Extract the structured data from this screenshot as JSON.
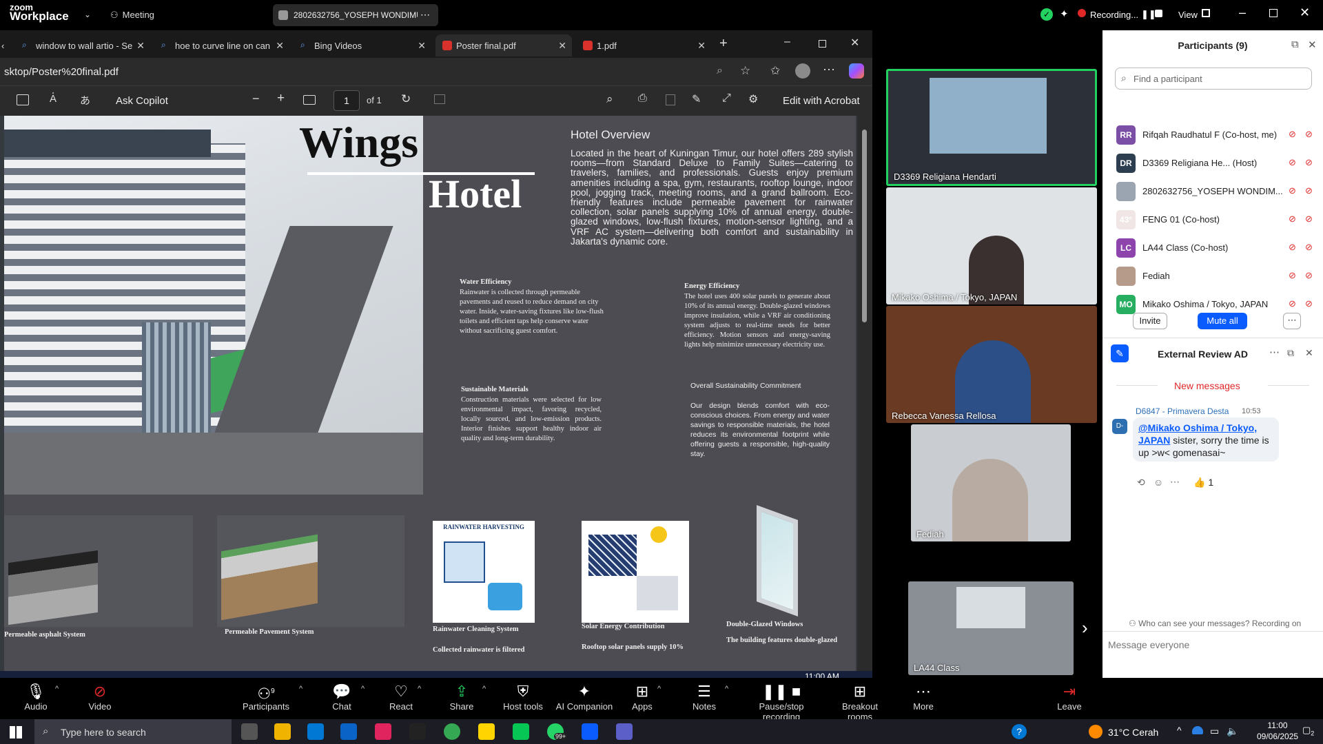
{
  "zoom_top": {
    "brand_small": "zoom",
    "brand_large": "Workplace",
    "meeting_label": "Meeting",
    "shared_screen_label": "2802632756_YOSEPH WONDIMU I",
    "recording_label": "Recording...",
    "view_label": "View"
  },
  "browser": {
    "tabs": [
      {
        "label": "window to wall artio - Se",
        "active": false
      },
      {
        "label": "hoe to curve line on can",
        "active": false
      },
      {
        "label": "Bing Videos",
        "active": false
      },
      {
        "label": "Poster final.pdf",
        "active": true
      },
      {
        "label": "1.pdf",
        "active": false
      }
    ],
    "address": "sktop/Poster%20final.pdf",
    "pdf_toolbar": {
      "ask_copilot": "Ask Copilot",
      "page_current": "1",
      "page_total": "of 1",
      "edit_acrobat": "Edit with Acrobat"
    }
  },
  "poster": {
    "title_1": "Wings",
    "title_2": "Hotel",
    "overview_heading": "Hotel Overview",
    "overview_body": "Located in the heart of Kuningan Timur, our hotel offers 289 stylish rooms—from Standard Deluxe to Family Suites—catering to travelers, families, and professionals. Guests enjoy premium amenities including a spa, gym, restaurants, rooftop lounge, indoor pool, jogging track, meeting rooms, and a grand ballroom. Eco-friendly features include permeable pavement for rainwater collection, solar panels supplying 10% of annual energy, double-glazed windows, low-flush fixtures, motion-sensor lighting, and a VRF AC system—delivering both comfort and sustainability in Jakarta's dynamic core.",
    "water_heading": "Water Efficiency",
    "water_body": "Rainwater is collected through permeable pavements and reused to reduce demand on city water. Inside, water-saving fixtures like low-flush toilets and efficient taps help conserve water without sacrificing guest comfort.",
    "energy_heading": "Energy Efficiency",
    "energy_body": "The hotel uses 400 solar panels to generate about 10% of its annual energy. Double-glazed windows improve insulation, while a VRF air conditioning system adjusts to real-time needs for better efficiency. Motion sensors and energy-saving lights help minimize unnecessary electricity use.",
    "materials_heading": "Sustainable Materials",
    "materials_body": "Construction materials were selected for low environmental impact, favoring recycled, locally sourced, and low-emission products. Interior finishes support healthy indoor air quality and long-term durability.",
    "commitment_heading": "Overall Sustainability Commitment",
    "commitment_body": "Our design blends comfort with eco-conscious choices. From energy and water savings to responsible materials, the hotel reduces its environmental footprint while offering guests a responsible, high-quality stay.",
    "rainwater_graphic_title": "RAINWATER HARVESTING",
    "captions": [
      "Permeable asphalt System",
      "Permeable Pavement System",
      "Rainwater Cleaning System",
      "Solar Energy Contribution",
      "Double-Glazed Windows"
    ],
    "cut_lines": [
      "Collected rainwater is filtered",
      "Rooftop solar panels supply 10%",
      "The building features double-glazed"
    ]
  },
  "videos": [
    {
      "name": "D3369 Religiana Hendarti"
    },
    {
      "name": "Mikako Oshima / Tokyo, JAPAN"
    },
    {
      "name": "Rebecca Vanessa Rellosa"
    },
    {
      "name": "Fediah"
    },
    {
      "name": "LA44 Class"
    }
  ],
  "participants": {
    "title": "Participants (9)",
    "search_placeholder": "Find a participant",
    "list": [
      {
        "initials": "RR",
        "name": "Rifqah Raudhatul F (Co-host, me)",
        "color": "#7b4fa6"
      },
      {
        "initials": "DR",
        "name": "D3369 Religiana He... (Host)",
        "color": "#2d3e50"
      },
      {
        "initials": "",
        "name": "2802632756_YOSEPH WONDIM...",
        "color": "#9aa5b1"
      },
      {
        "initials": "43°",
        "name": "FENG 01 (Co-host)",
        "color": "#f0e6e6"
      },
      {
        "initials": "LC",
        "name": "LA44 Class (Co-host)",
        "color": "#8e44ad"
      },
      {
        "initials": "",
        "name": "Fediah",
        "color": "#b69a8a"
      },
      {
        "initials": "MO",
        "name": "Mikako Oshima / Tokyo, JAPAN",
        "color": "#27ae60"
      }
    ],
    "invite": "Invite",
    "mute_all": "Mute all"
  },
  "chat": {
    "title": "External Review AD",
    "new_messages": "New messages",
    "sender": "D6847 - Primavera Desta",
    "time": "10:53",
    "mention": "@Mikako Oshima / Tokyo, JAPAN",
    "message": " sister, sorry the time is up >w< gomenasai~",
    "reaction_count": "1",
    "who_can_see": "Who can see your messages? Recording on",
    "input_placeholder": "Message everyone"
  },
  "zoom_bar": {
    "audio": "Audio",
    "video": "Video",
    "participants": "Participants",
    "participants_count": "9",
    "chat": "Chat",
    "react": "React",
    "share": "Share",
    "host_tools": "Host tools",
    "ai_companion": "AI Companion",
    "apps": "Apps",
    "notes": "Notes",
    "pause_recording": "Pause/stop recording",
    "breakout": "Breakout rooms",
    "more": "More",
    "leave": "Leave"
  },
  "taskbar": {
    "search_placeholder": "Type here to search",
    "weather": "31°C  Cerah",
    "time": "11:00",
    "date": "09/06/2025",
    "notif_count": "2",
    "inner_time": "11:00 AM",
    "badge": "99+"
  },
  "colors": {
    "zoom_blue": "#0b5cff",
    "zoom_green_border": "#23d160",
    "leave_red": "#e02828"
  }
}
